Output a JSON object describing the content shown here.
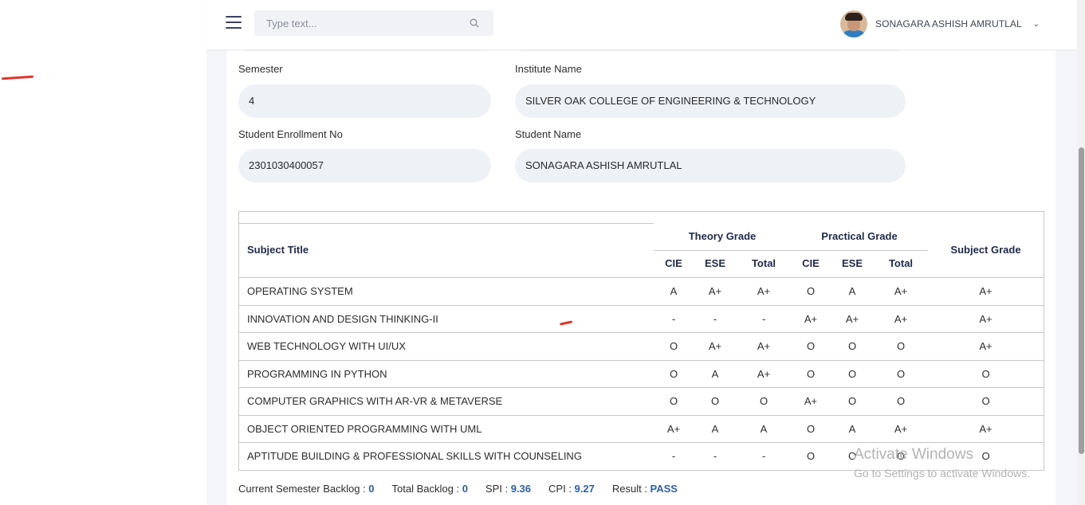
{
  "header": {
    "search_placeholder": "Type text...",
    "user_name": "SONAGARA ASHISH AMRUTLAL",
    "menu_icon": "hamburger-icon",
    "search_icon": "search-icon",
    "dropdown_icon": "chevron-down-icon"
  },
  "form": {
    "semester_label": "Semester",
    "semester_value": "4",
    "institute_label": "Institute Name",
    "institute_value": "SILVER OAK COLLEGE OF ENGINEERING & TECHNOLOGY",
    "enrollment_label": "Student Enrollment No",
    "enrollment_value": "2301030400057",
    "student_label": "Student Name",
    "student_value": "SONAGARA ASHISH AMRUTLAL"
  },
  "table": {
    "subject_header": "Subject Title",
    "theory_header": "Theory Grade",
    "practical_header": "Practical Grade",
    "subject_grade_header": "Subject Grade",
    "sub_headers": [
      "CIE",
      "ESE",
      "Total",
      "CIE",
      "ESE",
      "Total"
    ],
    "rows": [
      {
        "subject": "OPERATING SYSTEM",
        "t_cie": "A",
        "t_ese": "A+",
        "t_total": "A+",
        "p_cie": "O",
        "p_ese": "A",
        "p_total": "A+",
        "grade": "A+"
      },
      {
        "subject": "INNOVATION AND DESIGN THINKING-II",
        "t_cie": "-",
        "t_ese": "-",
        "t_total": "-",
        "p_cie": "A+",
        "p_ese": "A+",
        "p_total": "A+",
        "grade": "A+"
      },
      {
        "subject": "WEB TECHNOLOGY WITH UI/UX",
        "t_cie": "O",
        "t_ese": "A+",
        "t_total": "A+",
        "p_cie": "O",
        "p_ese": "O",
        "p_total": "O",
        "grade": "A+"
      },
      {
        "subject": "PROGRAMMING IN PYTHON",
        "t_cie": "O",
        "t_ese": "A",
        "t_total": "A+",
        "p_cie": "O",
        "p_ese": "O",
        "p_total": "O",
        "grade": "O"
      },
      {
        "subject": "COMPUTER GRAPHICS WITH AR-VR & METAVERSE",
        "t_cie": "O",
        "t_ese": "O",
        "t_total": "O",
        "p_cie": "A+",
        "p_ese": "O",
        "p_total": "O",
        "grade": "O"
      },
      {
        "subject": "OBJECT ORIENTED PROGRAMMING WITH UML",
        "t_cie": "A+",
        "t_ese": "A",
        "t_total": "A",
        "p_cie": "O",
        "p_ese": "A",
        "p_total": "A+",
        "grade": "A+"
      },
      {
        "subject": "APTITUDE BUILDING & PROFESSIONAL SKILLS WITH COUNSELING",
        "t_cie": "-",
        "t_ese": "-",
        "t_total": "-",
        "p_cie": "O",
        "p_ese": "O",
        "p_total": "O",
        "grade": "O"
      }
    ]
  },
  "summary": {
    "current_backlog_label": "Current Semester Backlog : ",
    "current_backlog_value": "0",
    "total_backlog_label": "Total Backlog : ",
    "total_backlog_value": "0",
    "spi_label": "SPI : ",
    "spi_value": "9.36",
    "cpi_label": "CPI : ",
    "cpi_value": "9.27",
    "result_label": "Result : ",
    "result_value": "PASS"
  },
  "watermark": {
    "line1": "Activate Windows",
    "line2": "Go to Settings to activate Windows."
  },
  "colors": {
    "accent_value": "#2f5fa0",
    "header_text": "#1e2a4a",
    "annotation_red": "#e0352b"
  }
}
